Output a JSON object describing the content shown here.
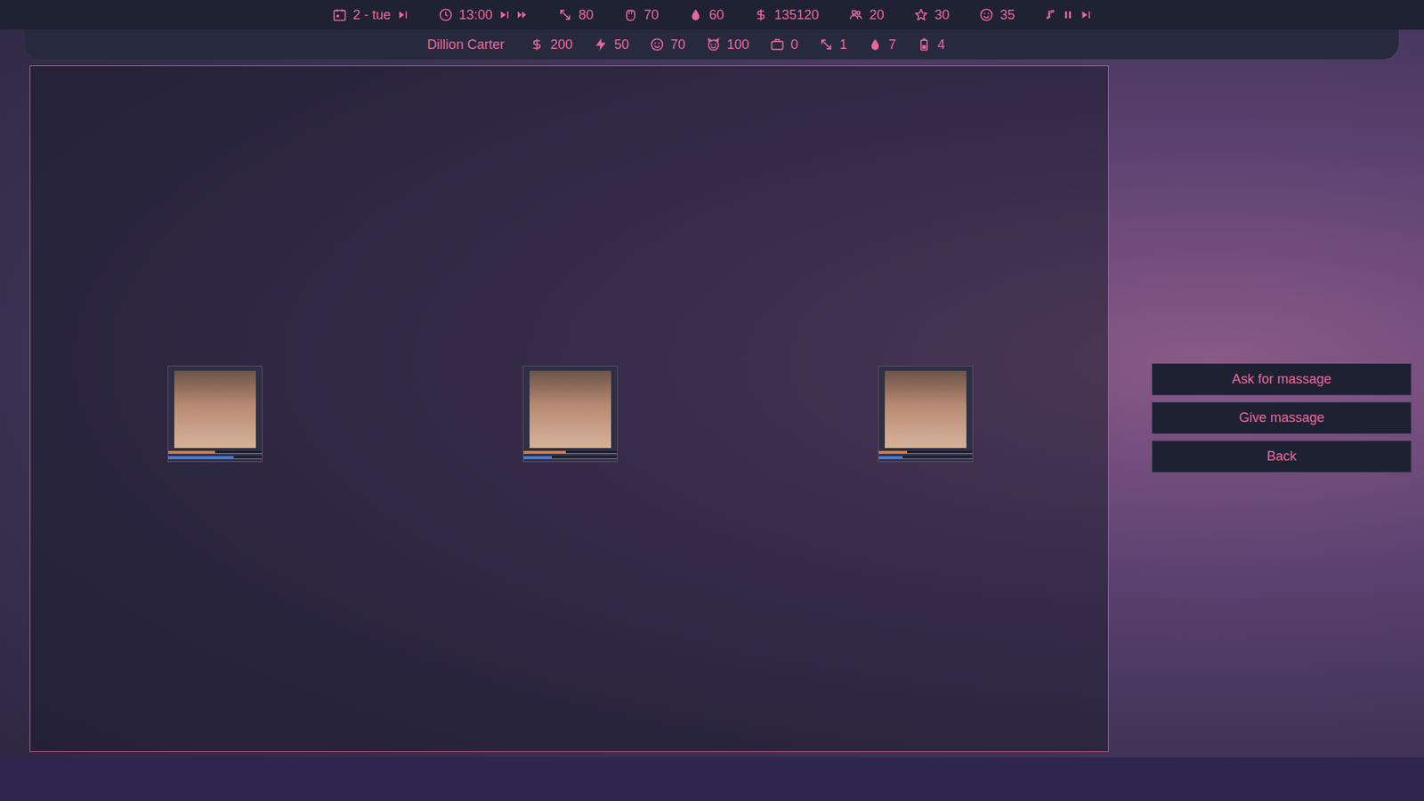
{
  "top_bar": {
    "day": "2 - tue",
    "time": "13:00",
    "stats": [
      {
        "value": "80"
      },
      {
        "value": "70"
      },
      {
        "value": "60"
      },
      {
        "value": "135120"
      },
      {
        "value": "20"
      },
      {
        "value": "30"
      },
      {
        "value": "35"
      }
    ]
  },
  "character": {
    "name": "Dillion Carter",
    "stats": [
      {
        "value": "200"
      },
      {
        "value": "50"
      },
      {
        "value": "70"
      },
      {
        "value": "100"
      },
      {
        "value": "0"
      },
      {
        "value": "1"
      },
      {
        "value": "7"
      },
      {
        "value": "4"
      }
    ]
  },
  "portraits": [
    {
      "bars": [
        {
          "level": 0.5,
          "color": "#e07a3c"
        },
        {
          "level": 0.7,
          "color": "#3d7be0"
        }
      ]
    },
    {
      "bars": [
        {
          "level": 0.45,
          "color": "#e07a3c"
        },
        {
          "level": 0.3,
          "color": "#3d7be0"
        }
      ]
    },
    {
      "bars": [
        {
          "level": 0.3,
          "color": "#e07a3c"
        },
        {
          "level": 0.25,
          "color": "#3d7be0"
        }
      ]
    }
  ],
  "buttons": [
    "Ask for massage",
    "Give massage",
    "Back"
  ]
}
